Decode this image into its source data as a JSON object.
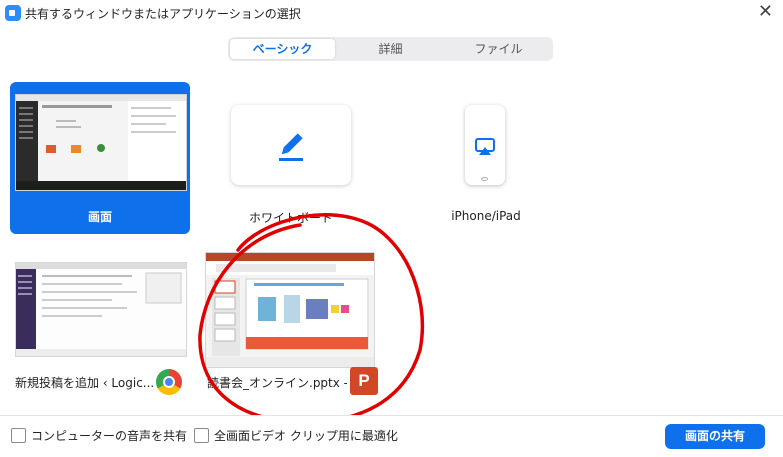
{
  "window": {
    "title": "共有するウィンドウまたはアプリケーションの選択",
    "close_glyph": "✕"
  },
  "tabs": [
    {
      "label": "ベーシック",
      "active": true
    },
    {
      "label": "詳細",
      "active": false
    },
    {
      "label": "ファイル",
      "active": false
    }
  ],
  "sources": [
    {
      "label": "画面",
      "icon": "desktop-screen-thumbnail",
      "selected": true
    },
    {
      "label": "ホワイトボード",
      "icon": "pencil-icon",
      "selected": false
    },
    {
      "label": "iPhone/iPad",
      "icon": "airplay-phone-icon",
      "selected": false
    }
  ],
  "windows": [
    {
      "label": "新規投稿を追加 ‹ Logic...",
      "app_icon": "chrome-icon"
    },
    {
      "label": "読書会_オンライン.pptx - ...",
      "app_icon": "powerpoint-icon",
      "app_icon_letter": "P"
    }
  ],
  "footer": {
    "share_audio_label": "コンピューターの音声を共有",
    "optimize_video_label": "全画面ビデオ クリップ用に最適化",
    "share_button": "画面の共有"
  },
  "colors": {
    "accent": "#0e71eb",
    "annotation": "#e00000"
  }
}
